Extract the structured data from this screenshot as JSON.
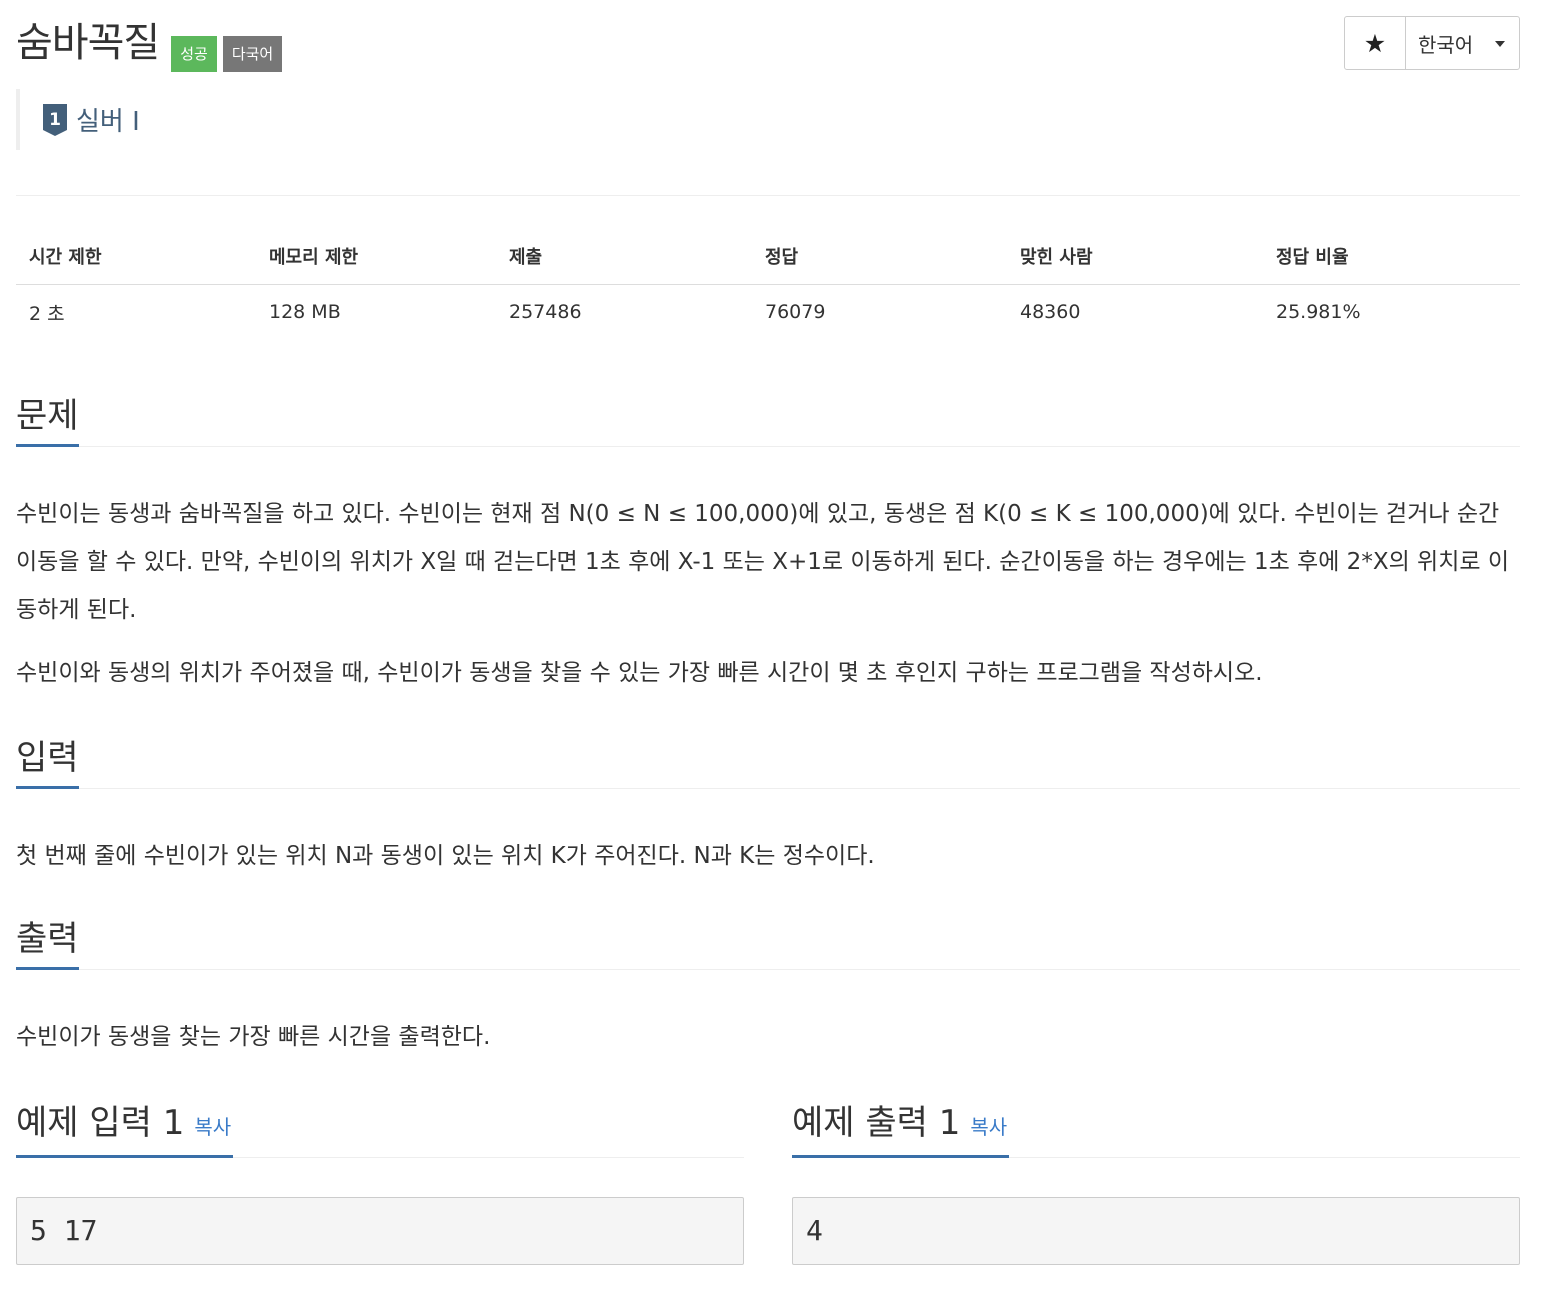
{
  "header": {
    "title": "숨바꼭질",
    "badges": [
      "성공",
      "다국어"
    ],
    "star_label": "★",
    "language_label": "한국어",
    "tier": "실버 I",
    "tier_number": "1"
  },
  "info_table": {
    "headers": [
      "시간 제한",
      "메모리 제한",
      "제출",
      "정답",
      "맞힌 사람",
      "정답 비율"
    ],
    "values": [
      "2 초",
      "128 MB",
      "257486",
      "76079",
      "48360",
      "25.981%"
    ]
  },
  "problem": {
    "heading": "문제",
    "paragraphs": [
      "수빈이는 동생과 숨바꼭질을 하고 있다. 수빈이는 현재 점 N(0 ≤ N ≤ 100,000)에 있고, 동생은 점 K(0 ≤ K ≤ 100,000)에 있다. 수빈이는 걷거나 순간이동을 할 수 있다. 만약, 수빈이의 위치가 X일 때 걷는다면 1초 후에 X-1 또는 X+1로 이동하게 된다. 순간이동을 하는 경우에는 1초 후에 2*X의 위치로 이동하게 된다.",
      "수빈이와 동생의 위치가 주어졌을 때, 수빈이가 동생을 찾을 수 있는 가장 빠른 시간이 몇 초 후인지 구하는 프로그램을 작성하시오."
    ]
  },
  "input": {
    "heading": "입력",
    "text": "첫 번째 줄에 수빈이가 있는 위치 N과 동생이 있는 위치 K가 주어진다. N과 K는 정수이다."
  },
  "output": {
    "heading": "출력",
    "text": "수빈이가 동생을 찾는 가장 빠른 시간을 출력한다."
  },
  "samples": {
    "input_heading": "예제 입력 1",
    "output_heading": "예제 출력 1",
    "copy_label": "복사",
    "input_value": "5 17",
    "output_value": "4"
  },
  "colors": {
    "success": "#5cb85c",
    "default_badge": "#777777",
    "accent": "#3a6fa8",
    "tier": "#435f7a",
    "link": "#3a7bc8"
  }
}
